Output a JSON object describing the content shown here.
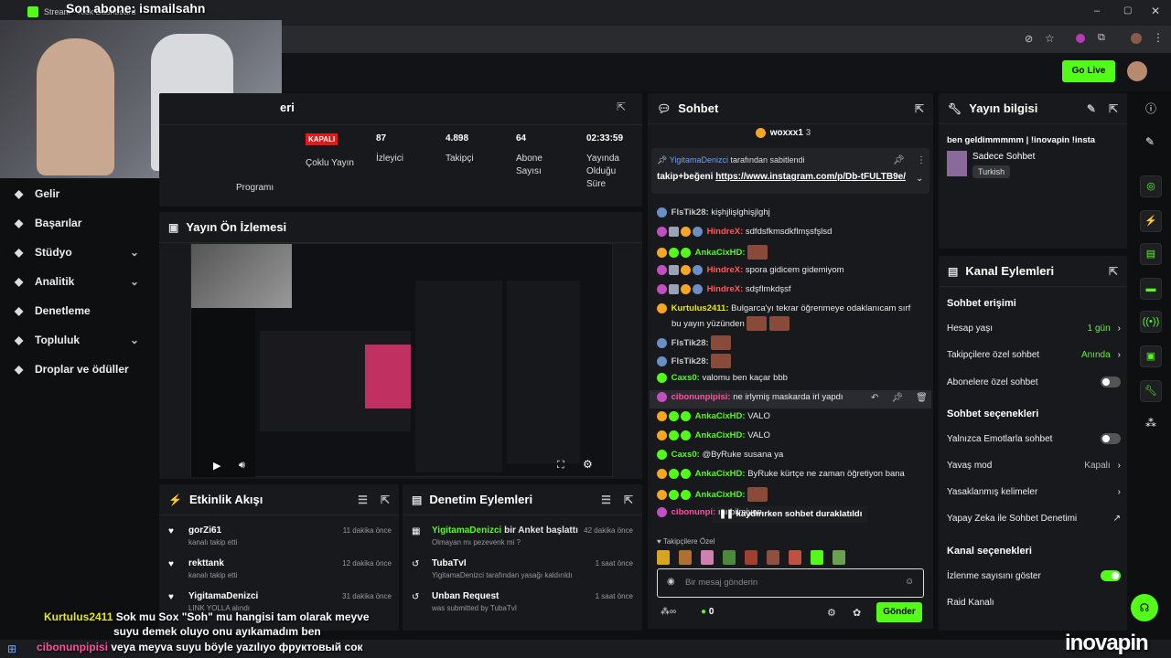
{
  "overlay": {
    "top_caption": "Son abone: ismailsahn"
  },
  "browser": {
    "tab_title": "Stream - Kick Dashboard"
  },
  "header": {
    "go_live": "Go Live"
  },
  "sidebar": {
    "items": [
      {
        "label": "Gelir",
        "icon": "dollar-icon",
        "chev": ""
      },
      {
        "label": "Başarılar",
        "icon": "trophy-icon",
        "chev": ""
      },
      {
        "label": "Stüdyo",
        "icon": "studio-icon",
        "chev": "⌄"
      },
      {
        "label": "Analitik",
        "icon": "chart-icon",
        "chev": "⌄"
      },
      {
        "label": "Denetleme",
        "icon": "wrench-icon",
        "chev": ""
      },
      {
        "label": "Topluluk",
        "icon": "community-icon",
        "chev": "⌄"
      },
      {
        "label": "Droplar ve ödüller",
        "icon": "gift-icon",
        "chev": ""
      }
    ]
  },
  "stats": {
    "partial_title": "eri",
    "status": "KAPALI",
    "multi": "Çoklu Yayın",
    "program": "Programı",
    "viewers": {
      "value": "87",
      "label": "İzleyici"
    },
    "followers": {
      "value": "4.898",
      "label": "Takipçi"
    },
    "subs": {
      "value": "64",
      "label": "Abone Sayısı"
    },
    "duration": {
      "value": "02:33:59",
      "label": "Yayında Olduğu Süre"
    }
  },
  "preview": {
    "title": "Yayın Ön İzlemesi"
  },
  "activity": {
    "title": "Etkinlik Akışı",
    "items": [
      {
        "name": "gorZi61",
        "sub": "kanalı takip etti",
        "time": "11 dakika önce"
      },
      {
        "name": "rekttank",
        "sub": "kanalı takip etti",
        "time": "12 dakika önce"
      },
      {
        "name": "YigitamaDenizci",
        "sub": "LINK YOLLA alındı",
        "time": "31 dakika önce"
      }
    ]
  },
  "moderation": {
    "title": "Denetim Eylemleri",
    "items": [
      {
        "name": "YigitamaDenizci",
        "text": "bir Anket başlattı",
        "sub": "Olmayan mı pezevenk mi ?",
        "time": "42 dakika önce"
      },
      {
        "name": "TubaTvI",
        "text": "",
        "sub": "YigitamaDenizci tarafından yasağı kaldırıldı",
        "time": "1 saat önce"
      },
      {
        "name": "Unban Request",
        "text": "",
        "sub": "was submitted by TubaTvI",
        "time": "1 saat önce"
      }
    ]
  },
  "chat": {
    "title": "Sohbet",
    "top_gifter": "woxxx1",
    "top_count": "3",
    "pinned_by": "YigitamaDenizci",
    "pinned_suffix": "tarafından sabitlendi",
    "pinned_text": "takip+beğeni",
    "pinned_link": "https://www.instagram.com/p/Db-tFULTB9e/",
    "messages": [
      {
        "user": "FlsTik28",
        "text": "kişhjlişlghişjlghj",
        "color": "#c8c8c8"
      },
      {
        "user": "HindreX",
        "text": "sdfdsfkmsdkflmşsfşlsd",
        "color": "#ff5a5a"
      },
      {
        "user": "AnkaCixHD",
        "text": "",
        "color": "#53fc18"
      },
      {
        "user": "HindreX",
        "text": "spora gidicem gidemiyom",
        "color": "#ff5a5a"
      },
      {
        "user": "HindreX",
        "text": "sdşflmkdşsf",
        "color": "#ff5a5a"
      },
      {
        "user": "Kurtulus2411",
        "text": "Bulgarca'yı tekrar öğrenmeye odaklanıcam sırf",
        "color": "#e8e800"
      },
      {
        "user": "",
        "text": "bu yayın yüzünden",
        "color": "#fff"
      },
      {
        "user": "FlsTik28",
        "text": "",
        "color": "#c8c8c8"
      },
      {
        "user": "FlsTik28",
        "text": "",
        "color": "#c8c8c8"
      },
      {
        "user": "Caxs0",
        "text": "valomu ben kaçar bbb",
        "color": "#53fc18"
      },
      {
        "user": "cibonunpipisi",
        "text": "ne irlymiş maskarda irl yapdı",
        "color": "#ff4fa0"
      },
      {
        "user": "AnkaCixHD",
        "text": "VALO",
        "color": "#53fc18"
      },
      {
        "user": "AnkaCixHD",
        "text": "VALO",
        "color": "#53fc18"
      },
      {
        "user": "Caxs0",
        "text": "@ByRuke susana ya",
        "color": "#53fc18"
      },
      {
        "user": "AnkaCixHD",
        "text": "ByRuke kürtçe ne zaman öğretiyon bana",
        "color": "#53fc18"
      },
      {
        "user": "AnkaCixHD",
        "text": "",
        "color": "#53fc18"
      },
      {
        "user": "cibonunpi",
        "text": "ını bilmiyon",
        "color": "#ff4fa0"
      }
    ],
    "paused": "kaydırırken sohbet duraklatıldı",
    "followers_only_label": "Takipçilere Özel",
    "input_placeholder": "Bir mesaj gönderin",
    "points": "0",
    "send": "Gönder"
  },
  "stream_info": {
    "title": "Yayın bilgisi",
    "stream_title": "ben geldimmmmm | !inovapin !insta",
    "category": "Sadece Sohbet",
    "tag": "Turkish"
  },
  "channel_actions": {
    "title": "Kanal Eylemleri",
    "chat_access": "Sohbet erişimi",
    "account_age": "Hesap yaşı",
    "account_age_val": "1 gün",
    "followers_chat": "Takipçilere özel sohbet",
    "followers_chat_val": "Anında",
    "subs_chat": "Abonelere özel sohbet",
    "chat_options": "Sohbet seçenekleri",
    "emote_only": "Yalnızca Emotlarla sohbet",
    "slow_mode": "Yavaş mod",
    "slow_mode_val": "Kapalı",
    "banned_words": "Yasaklanmış kelimeler",
    "ai_mod": "Yapay Zeka ile Sohbet Denetimi",
    "channel_options": "Kanal seçenekleri",
    "show_viewers": "İzlenme sayısını göster",
    "raid": "Raid Kanalı"
  },
  "bottom_overlay": {
    "user": "Kurtulus2411",
    "line1": "Sok mu Sox \"Soh\" mu hangisi tam olarak meyve",
    "line2": "suyu demek oluyo onu ayıkamadım ben",
    "line3_user": "cibonunpipisi",
    "line3": "veya meyva suyu böyle yazılıyo фруктовый сок",
    "brand": "inovapin"
  }
}
